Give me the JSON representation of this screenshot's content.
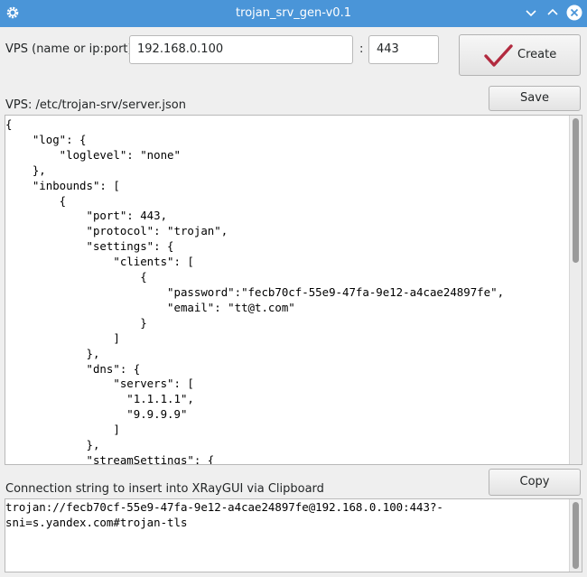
{
  "window": {
    "title": "trojan_srv_gen-v0.1",
    "app_icon": "gear-icon",
    "titlebar_color": "#4a95d8",
    "controls": [
      "chevron-down-icon",
      "chevron-up-icon",
      "close-icon"
    ]
  },
  "vps": {
    "label": "VPS (name or ip:port)",
    "host_value": "192.168.0.100",
    "separator": ":",
    "port_value": "443"
  },
  "create_button": {
    "label": "Create",
    "icon": "checkmark-icon",
    "icon_color": "#b22a3f"
  },
  "save_button": {
    "label": "Save"
  },
  "config": {
    "path_label": "VPS: /etc/trojan-srv/server.json",
    "content": "{\n    \"log\": {\n        \"loglevel\": \"none\"\n    },\n    \"inbounds\": [\n        {\n            \"port\": 443,\n            \"protocol\": \"trojan\",\n            \"settings\": {\n                \"clients\": [\n                    {\n                        \"password\":\"fecb70cf-55e9-47fa-9e12-a4cae24897fe\",\n                        \"email\": \"tt@t.com\"\n                    }\n                ]\n            },\n            \"dns\": {\n                \"servers\": [\n                  \"1.1.1.1\",\n                  \"9.9.9.9\"\n                ]\n            },\n            \"streamSettings\": {"
  },
  "connection": {
    "label": "Connection string to insert into XRayGUI via Clipboard",
    "copy_label": "Copy",
    "content": "trojan://fecb70cf-55e9-47fa-9e12-a4cae24897fe@192.168.0.100:443?-\nsni=s.yandex.com#trojan-tls"
  }
}
